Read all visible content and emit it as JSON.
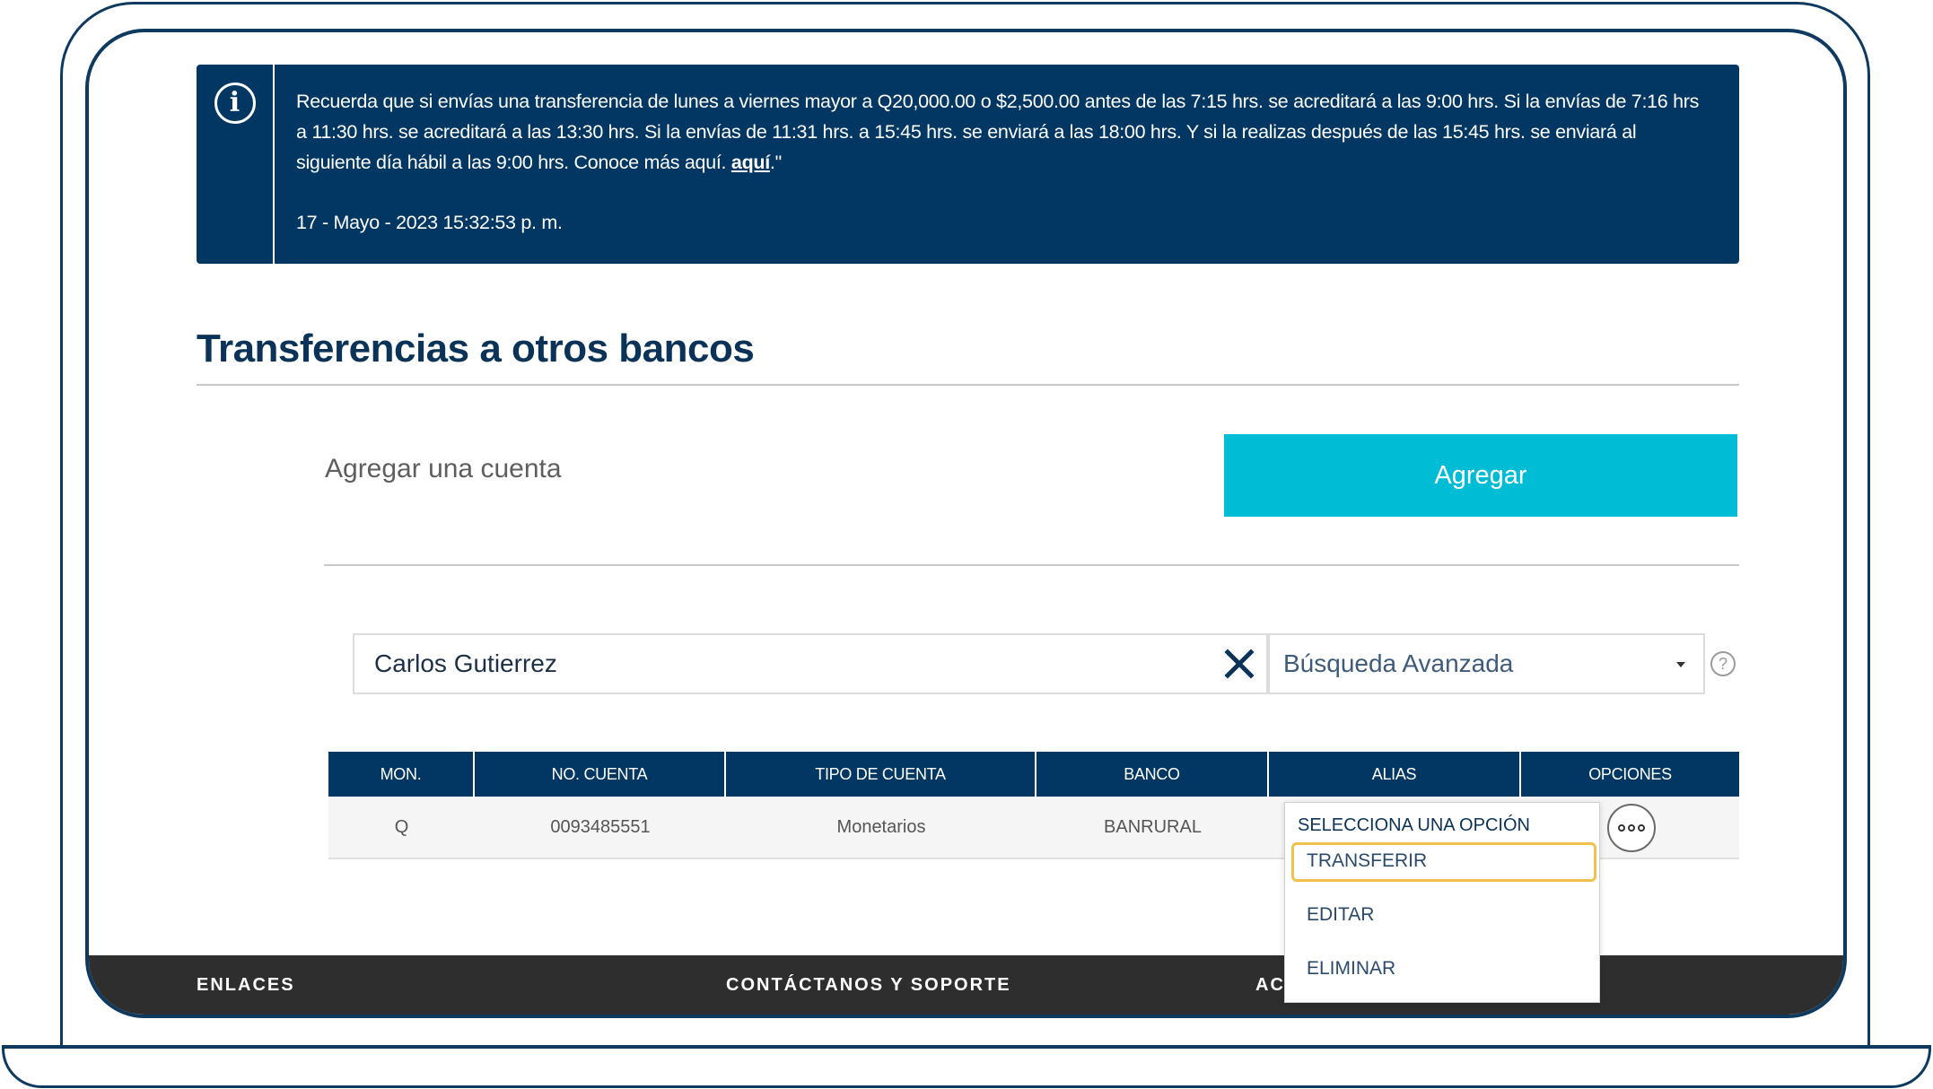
{
  "notice": {
    "icon": "info-icon",
    "message": "Recuerda que si envías una transferencia de lunes a viernes mayor a Q20,000.00 o $2,500.00 antes de las 7:15 hrs. se acreditará a las 9:00 hrs. Si la envías de 7:16 hrs a 11:30 hrs. se acreditará a las 13:30 hrs. Si la envías de 11:31 hrs. a 15:45 hrs. se enviará a las 18:00 hrs. Y si la realizas después de las 15:45 hrs. se enviará al siguiente día hábil a las 9:00 hrs. Conoce más aquí.",
    "link_text": "aquí",
    "suffix": ".\"",
    "date": "17 - Mayo - 2023 15:32:53 p. m."
  },
  "page": {
    "title": "Transferencias a otros bancos"
  },
  "add_account": {
    "label": "Agregar una cuenta",
    "button": "Agregar"
  },
  "search": {
    "value": "Carlos Gutierrez",
    "clear_icon": "close-icon",
    "advanced_label": "Búsqueda Avanzada",
    "help_label": "?"
  },
  "table": {
    "headers": [
      "MON.",
      "NO. CUENTA",
      "TIPO DE CUENTA",
      "BANCO",
      "ALIAS",
      "OPCIONES"
    ],
    "rows": [
      {
        "currency": "Q",
        "account": "0093485551",
        "type": "Monetarios",
        "bank": "BANRURAL",
        "alias": ""
      }
    ]
  },
  "options_menu": {
    "header": "SELECCIONA UNA OPCIÓN",
    "items": [
      "TRANSFERIR",
      "EDITAR",
      "ELIMINAR"
    ]
  },
  "footer": {
    "headings": [
      "ENLACES",
      "CONTÁCTANOS Y SOPORTE",
      "AC"
    ]
  },
  "colors": {
    "navy": "#033763",
    "accent": "#00bcd4",
    "highlight": "#f0c24b",
    "footer": "#2e2e2e"
  }
}
